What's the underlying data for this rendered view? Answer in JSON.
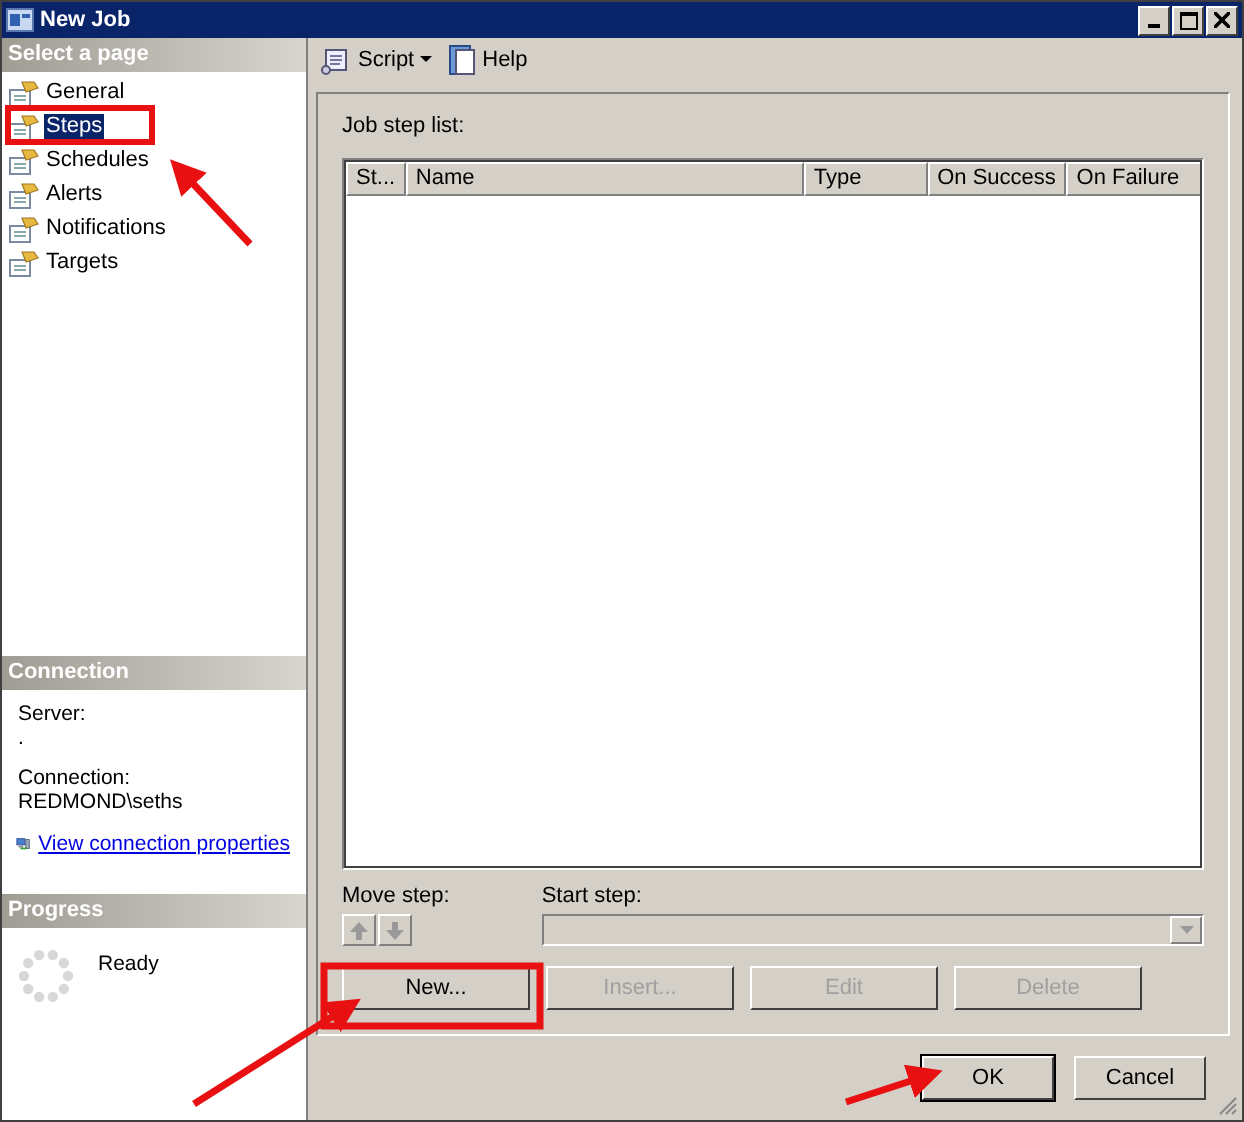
{
  "window": {
    "title": "New Job"
  },
  "sidebar": {
    "header": "Select a page",
    "items": [
      {
        "label": "General",
        "selected": false
      },
      {
        "label": "Steps",
        "selected": true
      },
      {
        "label": "Schedules",
        "selected": false
      },
      {
        "label": "Alerts",
        "selected": false
      },
      {
        "label": "Notifications",
        "selected": false
      },
      {
        "label": "Targets",
        "selected": false
      }
    ]
  },
  "connection": {
    "header": "Connection",
    "server_label": "Server:",
    "server_value": ".",
    "connection_label": "Connection:",
    "connection_value": "REDMOND\\seths",
    "link": "View connection properties"
  },
  "progress": {
    "header": "Progress",
    "status": "Ready"
  },
  "toolbar": [
    {
      "label": "Script",
      "kind": "script"
    },
    {
      "label": "Help",
      "kind": "help"
    }
  ],
  "job_step_list": {
    "label": "Job step list:",
    "columns": [
      "St...",
      "Name",
      "Type",
      "On Success",
      "On Failure"
    ]
  },
  "move_step": {
    "label": "Move step:",
    "up_disabled": true,
    "down_disabled": true
  },
  "start_step": {
    "label": "Start step:",
    "disabled": true
  },
  "step_buttons": [
    {
      "label": "New...",
      "disabled": false
    },
    {
      "label": "Insert...",
      "disabled": true
    },
    {
      "label": "Edit",
      "disabled": true
    },
    {
      "label": "Delete",
      "disabled": true
    }
  ],
  "dialog_buttons": [
    {
      "label": "OK",
      "default": true
    },
    {
      "label": "Cancel",
      "default": false
    }
  ]
}
